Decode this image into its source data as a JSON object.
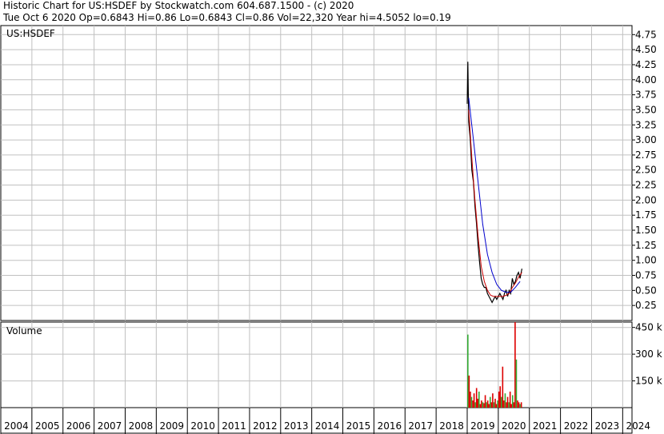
{
  "header": {
    "line1": "Historic Chart for US:HSDEF by Stockwatch.com 604.687.1500 - (c) 2020",
    "line2": "Tue Oct  6 2020   Op=0.6843   Hi=0.86   Lo=0.6843   Cl=0.86   Vol=22,320   Year hi=4.5052   lo=0.19"
  },
  "colors": {
    "price": "#000000",
    "ma_short": "#cc0000",
    "ma_long": "#0000cc",
    "vol_up": "#33aa33",
    "vol_down": "#dd0000",
    "grid": "#c0c0c0"
  },
  "chart_data": [
    {
      "type": "line",
      "title": "US:HSDEF",
      "xlabel": "",
      "ylabel": "",
      "xlim": [
        2004,
        2024.3
      ],
      "ylim": [
        0,
        4.9
      ],
      "y_ticks": [
        "0.25",
        "0.50",
        "0.75",
        "1.00",
        "1.25",
        "1.50",
        "1.75",
        "2.00",
        "2.25",
        "2.50",
        "2.75",
        "3.00",
        "3.25",
        "3.50",
        "3.75",
        "4.00",
        "4.25",
        "4.50",
        "4.75"
      ],
      "grid": true,
      "series": [
        {
          "values_x": [
            2019.0,
            2019.02,
            2019.05,
            2019.1,
            2019.15,
            2019.2,
            2019.25,
            2019.3,
            2019.35,
            2019.4,
            2019.45,
            2019.5,
            2019.55,
            2019.6,
            2019.65,
            2019.7,
            2019.75,
            2019.8,
            2019.85,
            2019.9,
            2019.95,
            2020.0,
            2020.05,
            2020.1,
            2020.15,
            2020.2,
            2020.25,
            2020.3,
            2020.35,
            2020.4,
            2020.45,
            2020.5,
            2020.55,
            2020.6,
            2020.65,
            2020.7,
            2020.76
          ],
          "values_y": [
            3.6,
            4.3,
            3.3,
            3.0,
            2.5,
            2.3,
            1.9,
            1.6,
            1.25,
            0.95,
            0.7,
            0.6,
            0.55,
            0.55,
            0.45,
            0.4,
            0.35,
            0.3,
            0.35,
            0.4,
            0.35,
            0.4,
            0.45,
            0.4,
            0.35,
            0.45,
            0.5,
            0.4,
            0.5,
            0.45,
            0.7,
            0.6,
            0.65,
            0.75,
            0.8,
            0.7,
            0.86
          ]
        },
        {
          "values_x": [
            2019.05,
            2019.15,
            2019.25,
            2019.35,
            2019.45,
            2019.55,
            2019.65,
            2019.75,
            2019.85,
            2019.95,
            2020.05,
            2020.15,
            2020.25,
            2020.35,
            2020.45,
            2020.55,
            2020.65,
            2020.76
          ],
          "values_y": [
            3.5,
            2.7,
            2.0,
            1.4,
            0.9,
            0.65,
            0.5,
            0.42,
            0.4,
            0.4,
            0.4,
            0.4,
            0.42,
            0.45,
            0.55,
            0.62,
            0.72,
            0.8
          ]
        },
        {
          "values_x": [
            2019.05,
            2019.2,
            2019.35,
            2019.5,
            2019.65,
            2019.8,
            2019.95,
            2020.1,
            2020.25,
            2020.4,
            2020.55,
            2020.7
          ],
          "values_y": [
            3.7,
            3.0,
            2.3,
            1.6,
            1.1,
            0.8,
            0.6,
            0.5,
            0.47,
            0.47,
            0.55,
            0.65
          ]
        }
      ]
    },
    {
      "type": "bar",
      "title": "Volume",
      "ylim": [
        0,
        480000
      ],
      "y_ticks": [
        "150 k",
        "300 k",
        "450 k"
      ],
      "x_ticks": [
        "2004",
        "2005",
        "2006",
        "2007",
        "2008",
        "2009",
        "2010",
        "2011",
        "2012",
        "2013",
        "2014",
        "2015",
        "2016",
        "2017",
        "2018",
        "2019",
        "2020",
        "2021",
        "2022",
        "2023",
        "2024"
      ],
      "x": [
        2019.0,
        2019.04,
        2019.08,
        2019.12,
        2019.16,
        2019.2,
        2019.24,
        2019.28,
        2019.32,
        2019.36,
        2019.4,
        2019.44,
        2019.48,
        2019.52,
        2019.56,
        2019.6,
        2019.64,
        2019.68,
        2019.72,
        2019.76,
        2019.8,
        2019.84,
        2019.88,
        2019.92,
        2019.96,
        2020.0,
        2020.04,
        2020.08,
        2020.12,
        2020.16,
        2020.2,
        2020.24,
        2020.28,
        2020.32,
        2020.36,
        2020.4,
        2020.44,
        2020.48,
        2020.52,
        2020.56,
        2020.6,
        2020.64,
        2020.68,
        2020.72
      ],
      "values": [
        410000,
        180000,
        90000,
        60000,
        40000,
        80000,
        30000,
        110000,
        50000,
        90000,
        20000,
        40000,
        30000,
        25000,
        70000,
        30000,
        40000,
        20000,
        60000,
        30000,
        80000,
        30000,
        50000,
        20000,
        40000,
        90000,
        120000,
        60000,
        230000,
        40000,
        80000,
        30000,
        60000,
        30000,
        90000,
        20000,
        70000,
        30000,
        480000,
        270000,
        40000,
        30000,
        20000,
        30000
      ]
    }
  ],
  "title_label": "US:HSDEF",
  "volume_label": "Volume"
}
